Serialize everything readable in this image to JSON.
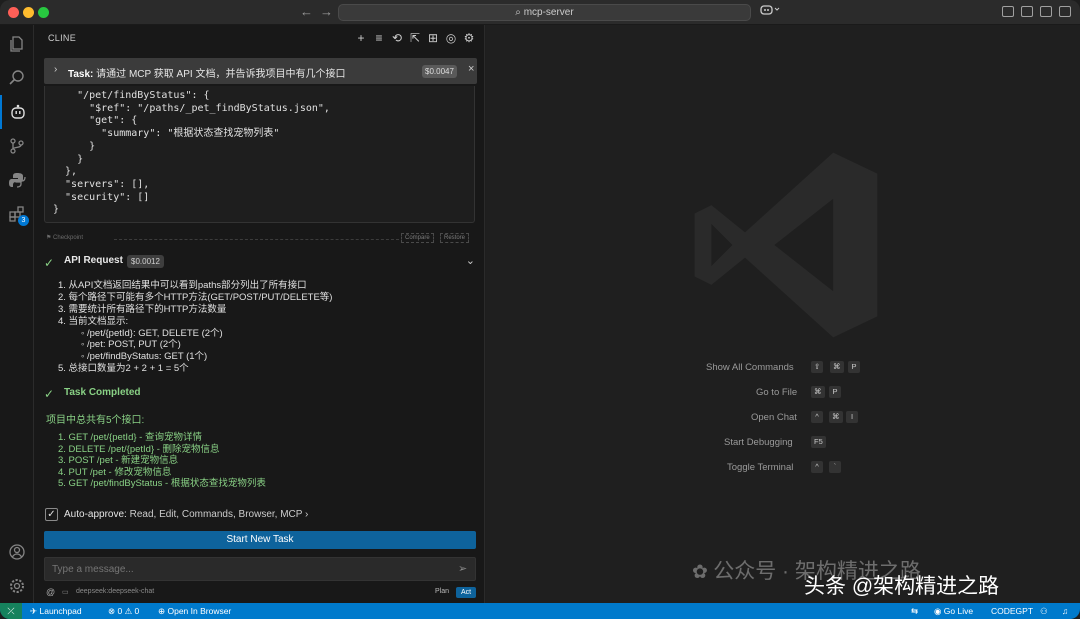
{
  "window": {
    "search_text": "mcp-server",
    "nav_back": "←",
    "nav_forward": "→",
    "copilot_icon": "copilot-icon"
  },
  "activity_bar": {
    "items": [
      {
        "name": "explorer-icon"
      },
      {
        "name": "search-icon"
      },
      {
        "name": "cline-icon"
      },
      {
        "name": "source-control-icon"
      },
      {
        "name": "python-icon"
      },
      {
        "name": "extensions-icon",
        "badge": "3"
      }
    ],
    "bottom_items": [
      {
        "name": "account-icon"
      },
      {
        "name": "manage-gear-icon"
      }
    ]
  },
  "cline": {
    "title": "CLINE",
    "header_actions": [
      "+",
      "≡",
      "⟲",
      "⇱",
      "⊞",
      "◎",
      "⚙"
    ],
    "task": {
      "prefix": "Task:",
      "text": "请通过 MCP 获取 API 文档，并告诉我项目中有几个接口",
      "cost": "$0.0047",
      "close": "×"
    },
    "code": "    \"/pet/findByStatus\": {\n      \"$ref\": \"/paths/_pet_findByStatus.json\",\n      \"get\": {\n        \"summary\": \"根据状态查找宠物列表\"\n      }\n    }\n  },\n  \"servers\": [],\n  \"security\": []\n}",
    "checkpoint": {
      "label": "Checkpoint",
      "compare": "Compare",
      "restore": "Restore"
    },
    "api_request": {
      "label": "API Request",
      "cost": "$0.0012"
    },
    "reasoning": [
      "1. 从API文档返回结果中可以看到paths部分列出了所有接口",
      "2. 每个路径下可能有多个HTTP方法(GET/POST/PUT/DELETE等)",
      "3. 需要统计所有路径下的HTTP方法数量",
      "4. 当前文档显示:"
    ],
    "sub_items": [
      "◦  /pet/{petId}: GET, DELETE (2个)",
      "◦  /pet: POST, PUT (2个)",
      "◦  /pet/findByStatus: GET (1个)"
    ],
    "reasoning_last": "5. 总接口数量为2 + 2 + 1 = 5个",
    "completed": {
      "label": "Task Completed"
    },
    "summary_head": "项目中总共有5个接口:",
    "summary_items": [
      "1. GET /pet/{petId} - 查询宠物详情",
      "2. DELETE /pet/{petId} - 删除宠物信息",
      "3. POST /pet - 新建宠物信息",
      "4. PUT /pet - 修改宠物信息",
      "5. GET /pet/findByStatus - 根据状态查找宠物列表"
    ],
    "auto_approve": {
      "label": "Auto-approve:",
      "value": "Read, Edit, Commands, Browser, MCP",
      "chevron": "›"
    },
    "start_new_task": "Start New Task",
    "message_placeholder": "Type a message...",
    "at_symbol": "@",
    "model": "deepseek:deepseek-chat",
    "mode_plan": "Plan",
    "mode_act": "Act"
  },
  "editor": {
    "shortcuts": [
      {
        "label": "Show All Commands",
        "keys": [
          "⇧",
          "⌘",
          "P"
        ]
      },
      {
        "label": "Go to File",
        "keys": [
          "⌘",
          "P"
        ]
      },
      {
        "label": "Open Chat",
        "keys": [
          "^",
          "⌘",
          "I"
        ]
      },
      {
        "label": "Start Debugging",
        "keys": [
          "F5"
        ]
      },
      {
        "label": "Toggle Terminal",
        "keys": [
          "^",
          "`"
        ]
      }
    ],
    "watermark_text": "公众号 · 架构精进之路",
    "overlay_text": "头条 @架构精进之路"
  },
  "statusbar": {
    "remote": "⤫",
    "launchpad": "Launchpad",
    "problems": "⊗ 0 ⚠ 0",
    "open_in_browser": "Open In Browser",
    "go_live": "Go Live",
    "codegpt": "CODEGPT"
  },
  "colors": {
    "accent": "#0078d4",
    "success": "#89d185",
    "statusbar": "#007acc",
    "button": "#0e639c"
  }
}
